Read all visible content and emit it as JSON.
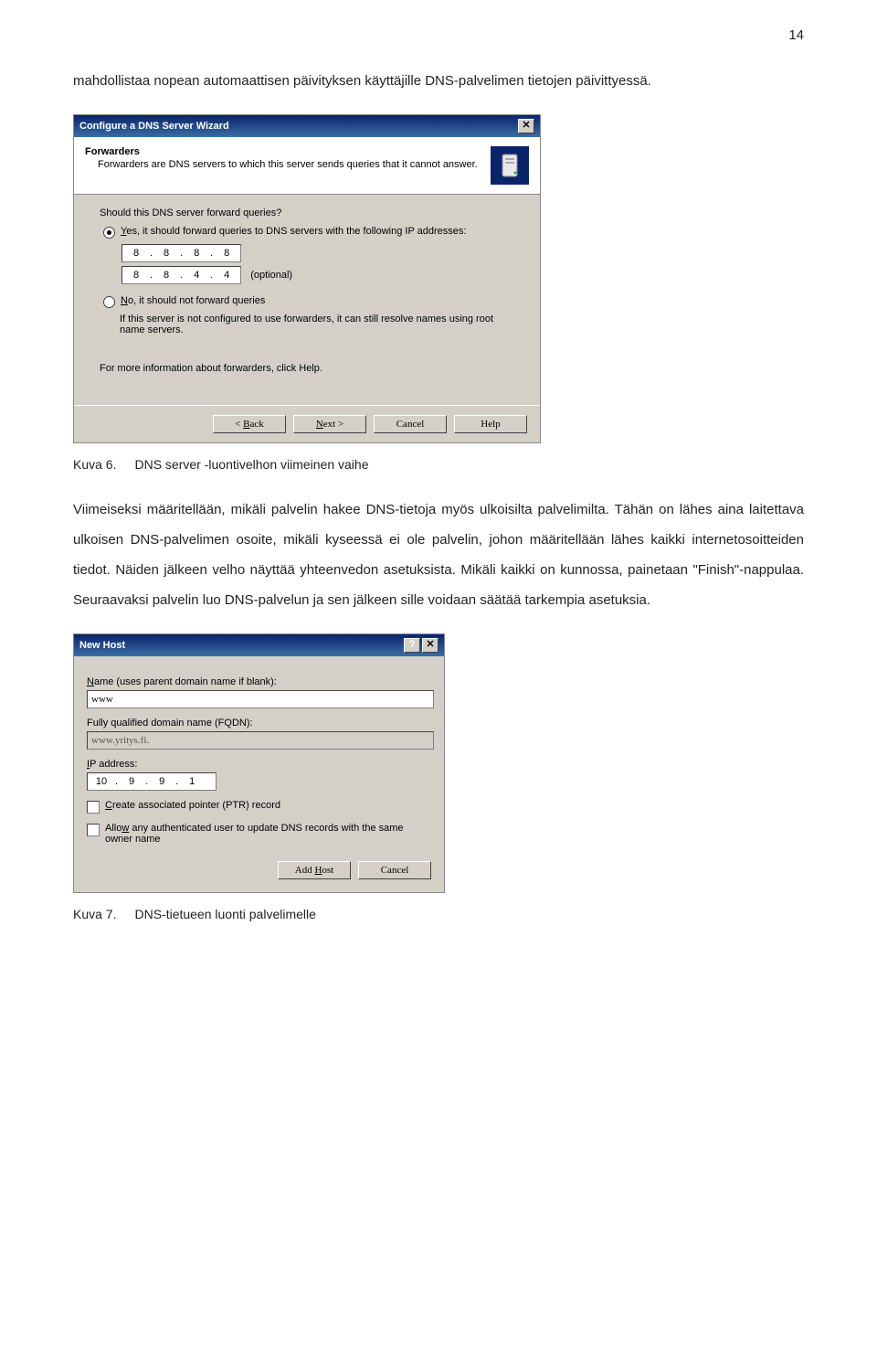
{
  "page_number": "14",
  "para_intro": "mahdollistaa nopean automaattisen päivityksen käyttäjille DNS-palvelimen tietojen päivittyessä.",
  "caption6": {
    "num": "Kuva 6.",
    "text": "DNS server -luontivelhon viimeinen vaihe"
  },
  "para_main": "Viimeiseksi määritellään, mikäli palvelin hakee DNS-tietoja myös ulkoisilta palvelimilta. Tähän on lähes aina laitettava ulkoisen DNS-palvelimen osoite, mikäli kyseessä ei ole palvelin, johon määritellään lähes kaikki internetosoitteiden tiedot. Näiden jälkeen velho näyttää yhteenvedon asetuksista. Mikäli kaikki on kunnossa, painetaan \"Finish\"-nappulaa. Seuraavaksi palvelin luo DNS-palvelun ja sen jälkeen sille voidaan säätää tarkempia asetuksia.",
  "caption7": {
    "num": "Kuva 7.",
    "text": "DNS-tietueen luonti palvelimelle"
  },
  "dlg1": {
    "title": "Configure a DNS Server Wizard",
    "header_title": "Forwarders",
    "header_desc": "Forwarders are DNS servers to which this server sends queries that it cannot answer.",
    "question": "Should this DNS server forward queries?",
    "opt_yes_pre": "Y",
    "opt_yes": "es, it should forward queries to DNS servers with the following IP addresses:",
    "ip1": [
      "8",
      "8",
      "8",
      "8"
    ],
    "ip2": [
      "8",
      "8",
      "4",
      "4"
    ],
    "optional": "(optional)",
    "opt_no_pre": "N",
    "opt_no": "o, it should not forward queries",
    "note": "If this server is not configured to use forwarders, it can still resolve names using root name servers.",
    "info": "For more information about forwarders, click Help.",
    "btn_back": "< Back",
    "btn_next": "Next >",
    "btn_cancel": "Cancel",
    "btn_help": "Help",
    "back_u": "B",
    "next_u": "N"
  },
  "dlg2": {
    "title": "New Host",
    "lbl_name_pre": "N",
    "lbl_name": "ame (uses parent domain name if blank):",
    "val_name": "www",
    "lbl_fqdn": "Fully qualified domain name (FQDN):",
    "val_fqdn": "www.yritys.fi.",
    "lbl_ip_pre": "I",
    "lbl_ip": "P address:",
    "ip": [
      "10",
      "9",
      "9",
      "1"
    ],
    "chk1_pre": "C",
    "chk1": "reate associated pointer (PTR) record",
    "chk2_pre1": "Allo",
    "chk2_u": "w",
    "chk2_post": " any authenticated user to update DNS records with the same owner name",
    "btn_add": "Add Host",
    "btn_cancel": "Cancel",
    "add_u": "H"
  }
}
